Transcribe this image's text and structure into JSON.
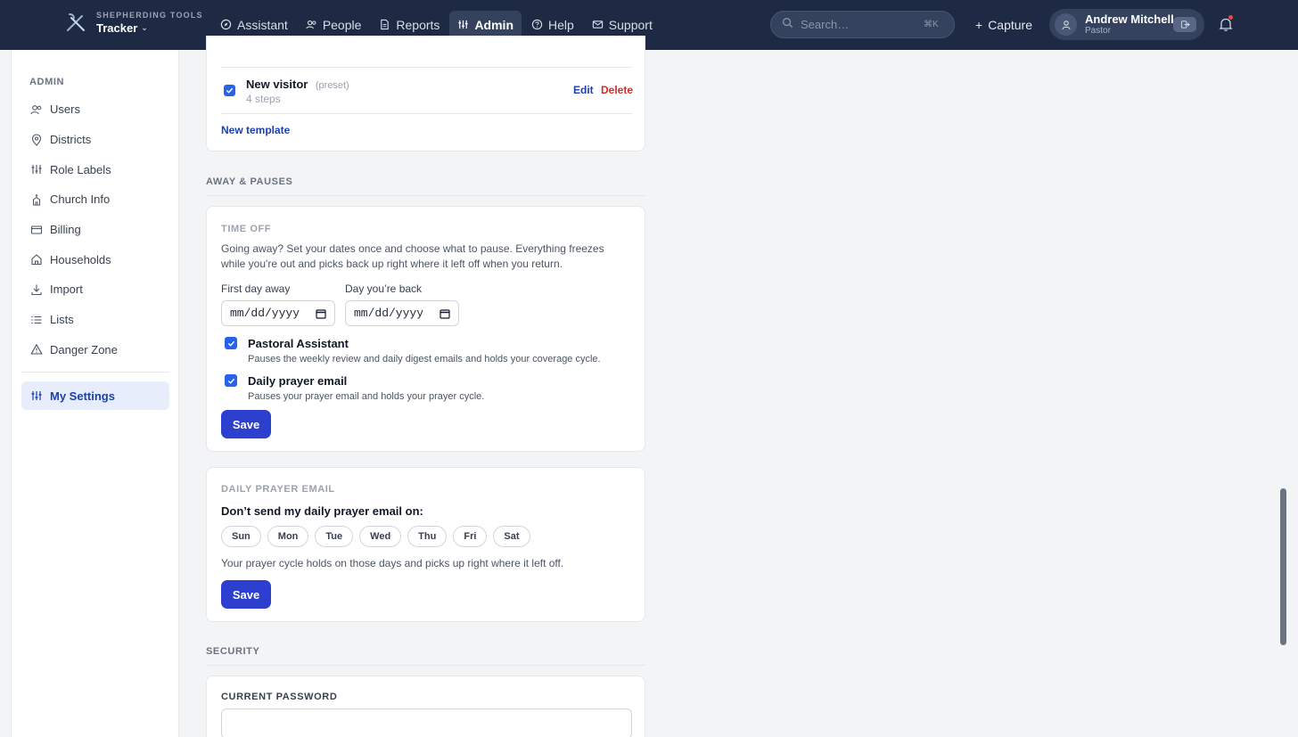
{
  "topbar": {
    "brand_sub": "SHEPHERDING TOOLS",
    "brand_name": "Tracker",
    "nav": [
      {
        "label": "Assistant"
      },
      {
        "label": "People"
      },
      {
        "label": "Reports"
      },
      {
        "label": "Admin"
      },
      {
        "label": "Help"
      },
      {
        "label": "Support"
      }
    ],
    "search_placeholder": "Search…",
    "search_shortcut": "⌘K",
    "capture_label": "Capture",
    "user_name": "Andrew Mitchell",
    "user_role": "Pastor"
  },
  "sidebar": {
    "heading": "ADMIN",
    "items": [
      {
        "label": "Users"
      },
      {
        "label": "Districts"
      },
      {
        "label": "Role Labels"
      },
      {
        "label": "Church Info"
      },
      {
        "label": "Billing"
      },
      {
        "label": "Households"
      },
      {
        "label": "Import"
      },
      {
        "label": "Lists"
      },
      {
        "label": "Danger Zone"
      }
    ],
    "active_item": "My Settings"
  },
  "templates": {
    "row_title": "New visitor",
    "row_tag": "(preset)",
    "row_steps": "4 steps",
    "edit_label": "Edit",
    "delete_label": "Delete",
    "new_template_label": "New template"
  },
  "away": {
    "section_label": "AWAY & PAUSES",
    "card_label": "TIME OFF",
    "description": "Going away? Set your dates once and choose what to pause. Everything freezes while you're out and picks back up right where it left off when you return.",
    "first_day_label": "First day away",
    "back_day_label": "Day you’re back",
    "date_placeholder": "mm/dd/yyyy",
    "options": [
      {
        "title": "Pastoral Assistant",
        "desc": "Pauses the weekly review and daily digest emails and holds your coverage cycle.",
        "checked": true
      },
      {
        "title": "Daily prayer email",
        "desc": "Pauses your prayer email and holds your prayer cycle.",
        "checked": true
      }
    ],
    "save_label": "Save"
  },
  "prayer": {
    "card_label": "DAILY PRAYER EMAIL",
    "heading": "Don’t send my daily prayer email on:",
    "days": [
      "Sun",
      "Mon",
      "Tue",
      "Wed",
      "Thu",
      "Fri",
      "Sat"
    ],
    "note": "Your prayer cycle holds on those days and picks up right where it left off.",
    "save_label": "Save"
  },
  "security": {
    "section_label": "SECURITY",
    "current_password_label": "CURRENT PASSWORD"
  },
  "colors": {
    "topbar": "#1e2a44",
    "accent": "#2d3fce",
    "link": "#1e40af",
    "danger": "#dc2626"
  }
}
